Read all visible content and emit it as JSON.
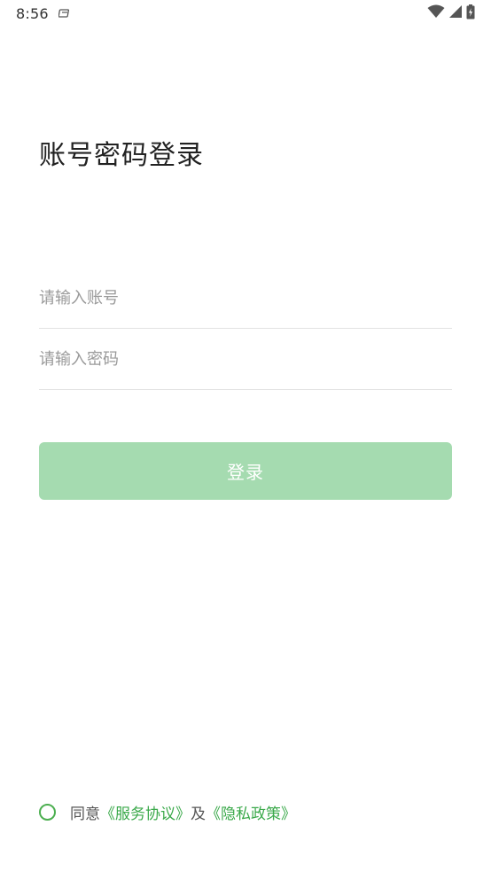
{
  "status_bar": {
    "time": "8:56",
    "notification_icon": "notification-icon",
    "wifi_icon": "wifi-icon",
    "signal_icon": "signal-icon",
    "battery_icon": "battery-charging-icon"
  },
  "page": {
    "title": "账号密码登录"
  },
  "form": {
    "account_placeholder": "请输入账号",
    "account_value": "",
    "password_placeholder": "请输入密码",
    "password_value": "",
    "login_button": "登录"
  },
  "agreement": {
    "prefix": "同意",
    "service_link": "《服务协议》",
    "conjunction": "及",
    "privacy_link": "《隐私政策》",
    "checked": false
  },
  "colors": {
    "accent_green": "#3aa94a",
    "button_disabled_green": "#a5dbb0",
    "divider": "#e3e3e3"
  }
}
